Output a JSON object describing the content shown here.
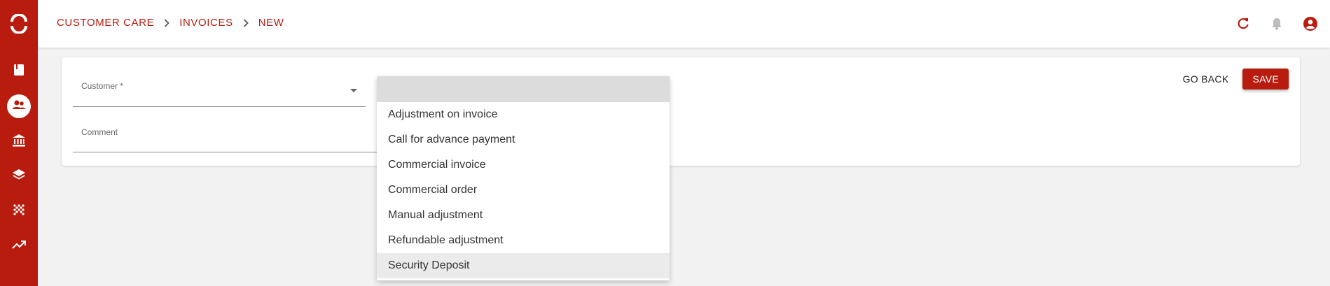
{
  "theme": {
    "accent": "#b71c0f",
    "surface": "#ffffff",
    "background": "#f2f2f2"
  },
  "sidebar": {
    "logo_icon": "brand-logo-icon",
    "items": [
      {
        "icon": "book-icon",
        "active": false
      },
      {
        "icon": "customers-icon",
        "active": true
      },
      {
        "icon": "bank-icon",
        "active": false
      },
      {
        "icon": "layers-icon",
        "active": false
      },
      {
        "icon": "grid-dots-icon",
        "active": false
      },
      {
        "icon": "trending-up-icon",
        "active": false
      }
    ]
  },
  "header": {
    "breadcrumb": [
      "CUSTOMER CARE",
      "INVOICES",
      "NEW"
    ],
    "icons": [
      "refresh-icon",
      "bell-icon",
      "account-icon"
    ]
  },
  "form": {
    "customer_label": "Customer *",
    "comment_label": "Comment",
    "comment_value": "",
    "go_back_label": "GO BACK",
    "save_label": "SAVE"
  },
  "dropdown": {
    "options": [
      "",
      "Adjustment on invoice",
      "Call for advance payment",
      "Commercial invoice",
      "Commercial order",
      "Manual adjustment",
      "Refundable adjustment",
      "Security Deposit"
    ],
    "highlighted": "Security Deposit"
  }
}
